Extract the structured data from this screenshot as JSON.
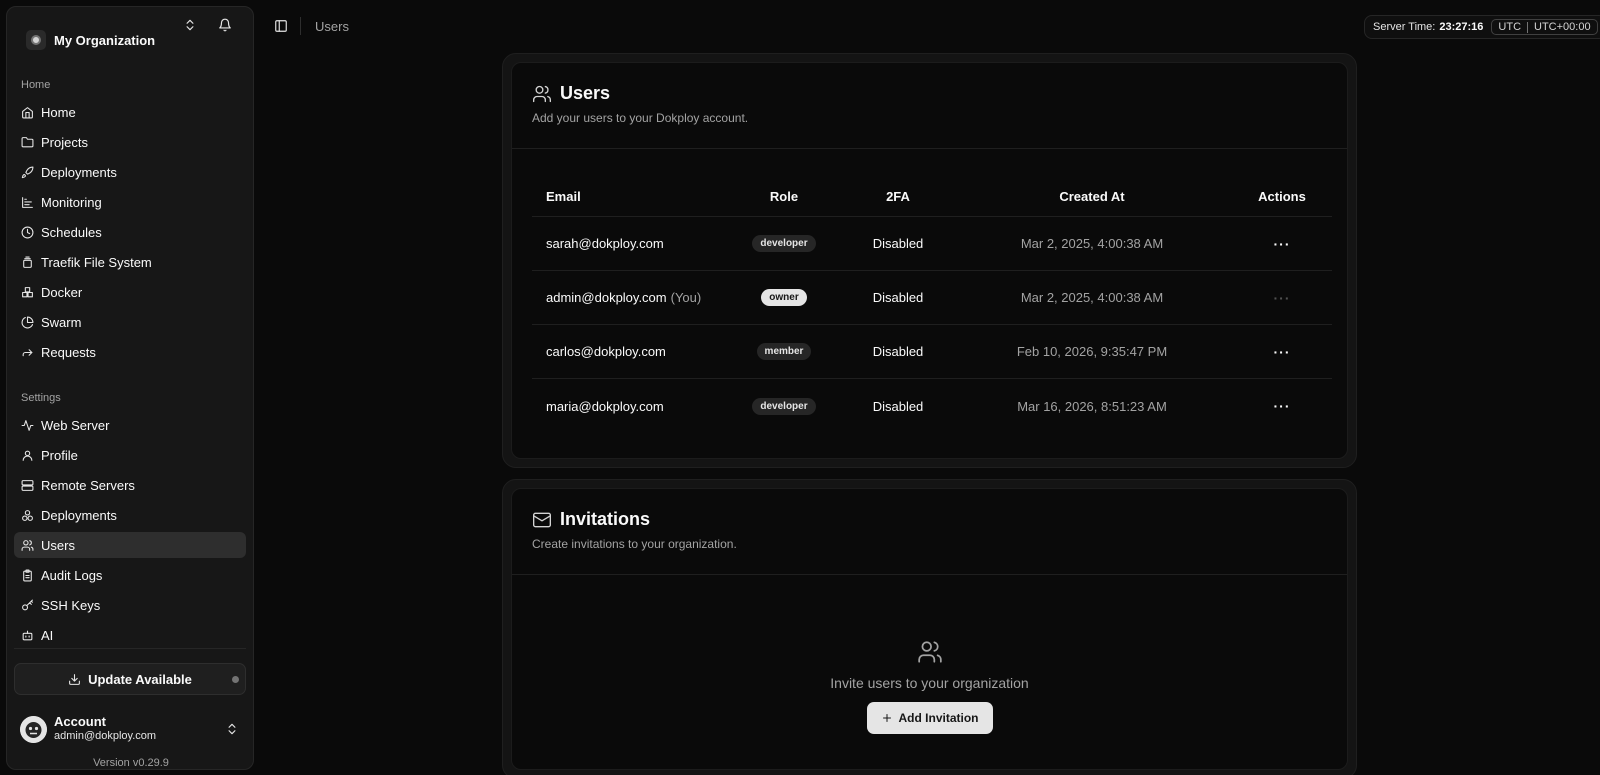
{
  "sidebar": {
    "org_name": "My Organization",
    "home_group": "Home",
    "home_items": [
      {
        "label": "Home",
        "icon": "home-icon"
      },
      {
        "label": "Projects",
        "icon": "folder-icon"
      },
      {
        "label": "Deployments",
        "icon": "rocket-icon"
      },
      {
        "label": "Monitoring",
        "icon": "chart-icon"
      },
      {
        "label": "Schedules",
        "icon": "clock-icon"
      },
      {
        "label": "Traefik File System",
        "icon": "file-stack-icon"
      },
      {
        "label": "Docker",
        "icon": "boxes-icon"
      },
      {
        "label": "Swarm",
        "icon": "pie-icon"
      },
      {
        "label": "Requests",
        "icon": "forward-icon"
      }
    ],
    "settings_group": "Settings",
    "settings_items": [
      {
        "label": "Web Server",
        "icon": "activity-icon"
      },
      {
        "label": "Profile",
        "icon": "user-icon"
      },
      {
        "label": "Remote Servers",
        "icon": "server-icon"
      },
      {
        "label": "Deployments",
        "icon": "boxes-icon"
      },
      {
        "label": "Users",
        "icon": "users-icon",
        "active": true
      },
      {
        "label": "Audit Logs",
        "icon": "clipboard-icon"
      },
      {
        "label": "SSH Keys",
        "icon": "key-icon"
      },
      {
        "label": "AI",
        "icon": "bot-icon"
      }
    ],
    "update_label": "Update Available",
    "account": {
      "title": "Account",
      "email": "admin@dokploy.com"
    },
    "version": "Version v0.29.9"
  },
  "topbar": {
    "breadcrumb": "Users",
    "server_time_label": "Server Time:",
    "server_time": "23:27:16",
    "tz_name": "UTC",
    "tz_offset": "UTC+00:00"
  },
  "users_card": {
    "title": "Users",
    "description": "Add your users to your Dokploy account.",
    "columns": [
      "Email",
      "Role",
      "2FA",
      "Created At",
      "Actions"
    ],
    "rows": [
      {
        "email": "sarah@dokploy.com",
        "you": "",
        "role": "developer",
        "twofa": "Disabled",
        "created": "Mar 2, 2025, 4:00:38 AM",
        "actions": "···"
      },
      {
        "email": "admin@dokploy.com",
        "you": "(You)",
        "role": "owner",
        "twofa": "Disabled",
        "created": "Mar 2, 2025, 4:00:38 AM",
        "actions": "···"
      },
      {
        "email": "carlos@dokploy.com",
        "you": "",
        "role": "member",
        "twofa": "Disabled",
        "created": "Feb 10, 2026, 9:35:47 PM",
        "actions": "···"
      },
      {
        "email": "maria@dokploy.com",
        "you": "",
        "role": "developer",
        "twofa": "Disabled",
        "created": "Mar 16, 2026, 8:51:23 AM",
        "actions": "···"
      }
    ]
  },
  "invitations_card": {
    "title": "Invitations",
    "description": "Create invitations to your organization.",
    "empty_text": "Invite users to your organization",
    "add_button": "Add Invitation"
  }
}
